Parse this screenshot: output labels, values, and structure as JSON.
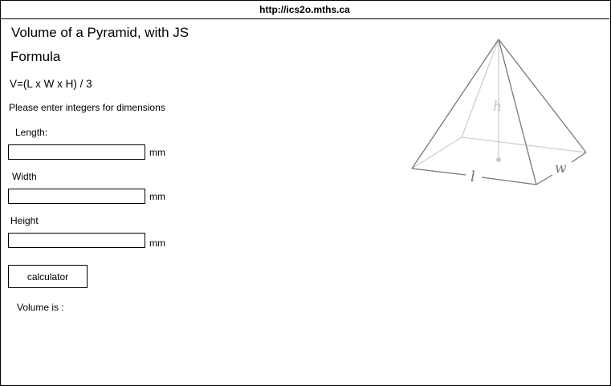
{
  "browser": {
    "url": "http://ics2o.mths.ca"
  },
  "page": {
    "title_line1": "Volume of a Pyramid, with JS",
    "title_line2": "Formula",
    "formula": "V=(L x W x H) / 3",
    "instructions": "Please enter integers for dimensions"
  },
  "form": {
    "length_label": "Length:",
    "width_label": "Width",
    "height_label": "Height",
    "length_value": "",
    "width_value": "",
    "height_value": "",
    "unit": "mm",
    "button_label": "calculator"
  },
  "result": {
    "label": "Volume is :"
  },
  "diagram": {
    "h_label": "h",
    "l_label": "l",
    "w_label": "w"
  }
}
